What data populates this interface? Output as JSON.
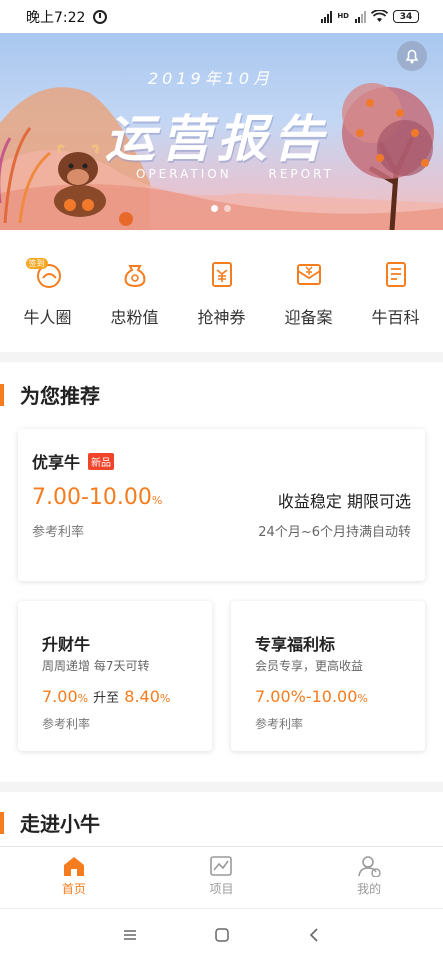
{
  "status_bar": {
    "time": "晚上7:22",
    "battery": "34",
    "network_label": "HD"
  },
  "banner": {
    "year_text": "2019年10月",
    "title": "运营报告",
    "subtitle": "OPERATION   REPORT",
    "slide_count": 2,
    "active_slide": 1
  },
  "quick_menu": [
    {
      "label": "牛人圈",
      "icon": "cow-circle-icon",
      "tag": "签到"
    },
    {
      "label": "忠粉值",
      "icon": "money-bag-icon"
    },
    {
      "label": "抢神券",
      "icon": "coupon-icon"
    },
    {
      "label": "迎备案",
      "icon": "yen-envelope-icon"
    },
    {
      "label": "牛百科",
      "icon": "document-icon"
    }
  ],
  "recommend": {
    "section_title": "为您推荐",
    "featured": {
      "name": "优享牛",
      "badge": "新品",
      "rate_value": "7.00-10.00",
      "rate_unit": "%",
      "rate_label": "参考利率",
      "feature": "收益稳定 期限可选",
      "desc": "24个月~6个月持满自动转"
    },
    "products": [
      {
        "name": "升财牛",
        "desc": "周周递增 每7天可转",
        "rate_start": "7.00",
        "rate_mid": "升至",
        "rate_end": "8.40",
        "unit": "%",
        "rate_label": "参考利率"
      },
      {
        "name": "专享福利标",
        "desc": "会员专享，更高收益",
        "rate_value": "7.00%-10.00",
        "unit": "%",
        "rate_label": "参考利率"
      }
    ]
  },
  "enter_section": {
    "title": "走进小牛"
  },
  "tab_bar": [
    {
      "label": "首页",
      "icon": "home-icon",
      "active": true
    },
    {
      "label": "项目",
      "icon": "chart-icon",
      "active": false
    },
    {
      "label": "我的",
      "icon": "user-icon",
      "active": false
    }
  ],
  "colors": {
    "accent": "#f57c1f",
    "badge_red": "#f0442b",
    "background": "#f4f4f4"
  }
}
